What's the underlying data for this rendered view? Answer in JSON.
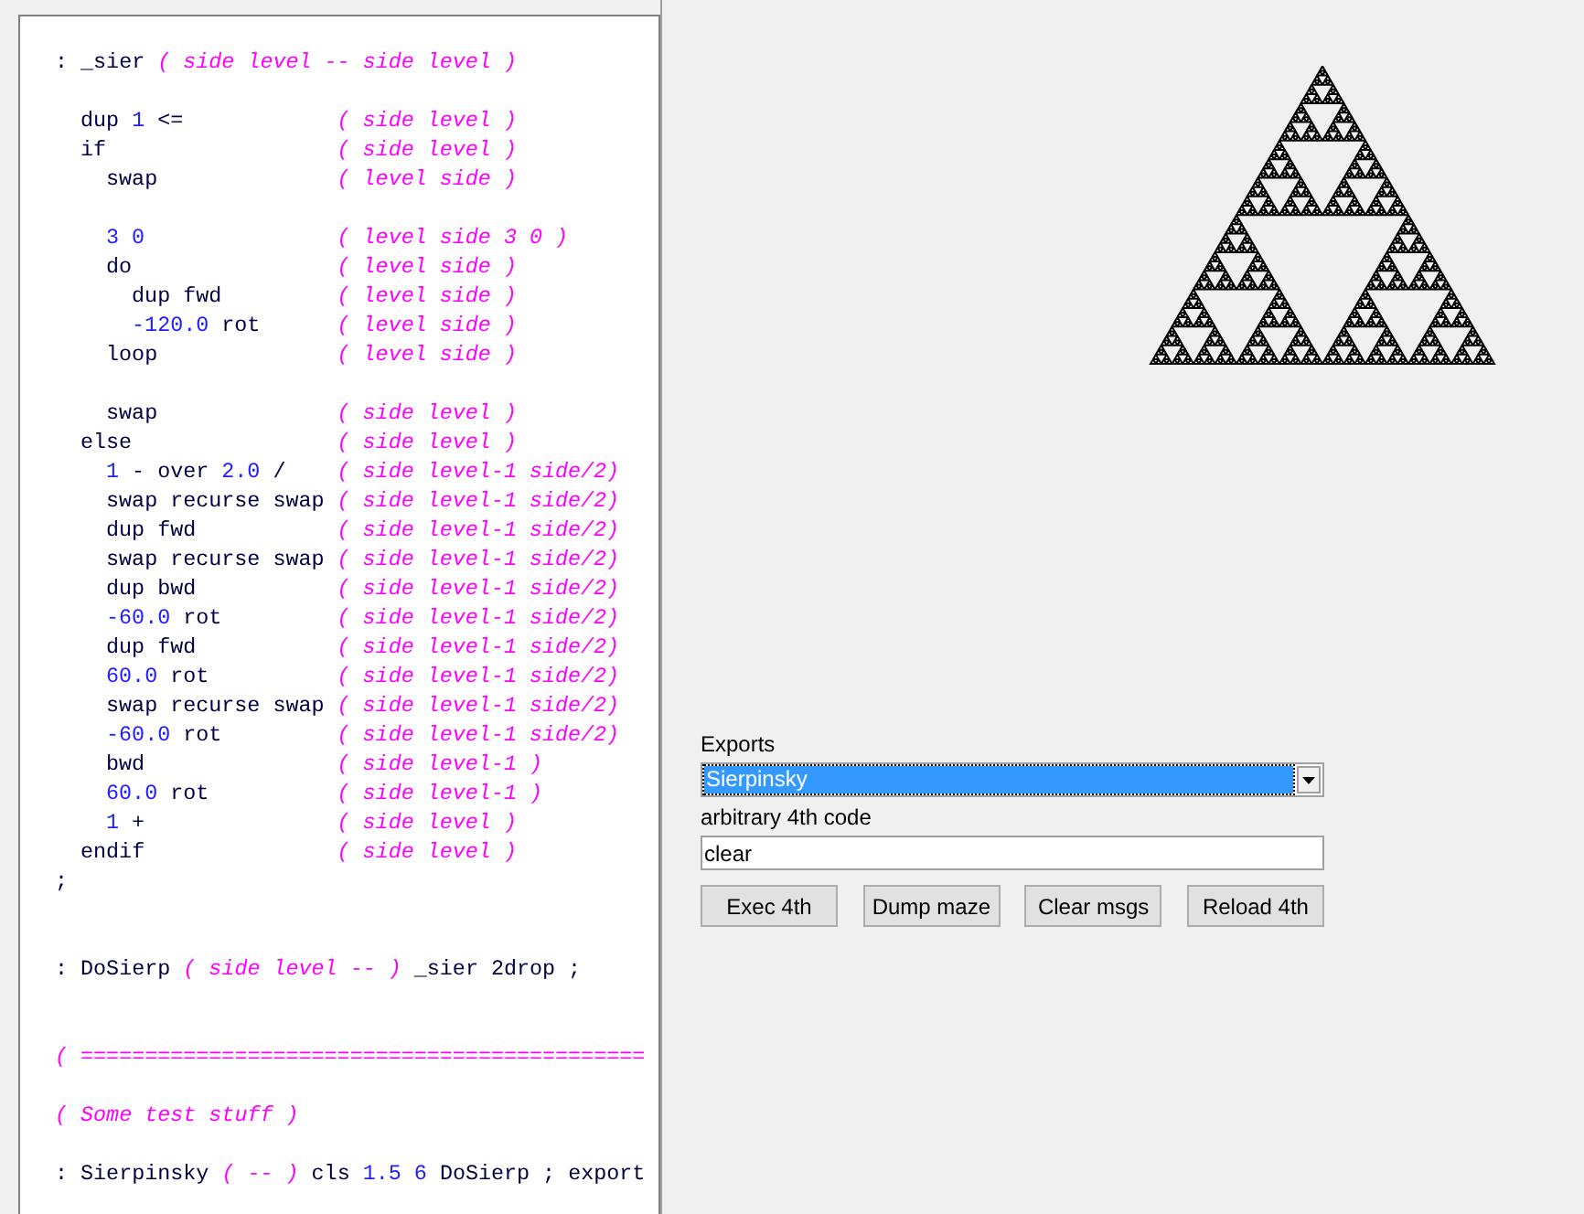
{
  "editor": {
    "lines": [
      {
        "kind": "code",
        "segments": [
          {
            "kind": "word",
            "t": ": _sier "
          },
          {
            "kind": "comment",
            "t": "( side level -- side level )"
          }
        ],
        "children": [
          {
            "kind": "blank"
          },
          {
            "kind": "code",
            "segments": [
              {
                "kind": "word",
                "t": "dup "
              },
              {
                "kind": "number",
                "t": "1"
              },
              {
                "kind": "word",
                "t": " <="
              }
            ],
            "comment": "( side level )"
          },
          {
            "kind": "code",
            "segments": [
              {
                "kind": "word",
                "t": "if"
              }
            ],
            "comment": "( side level )",
            "children": [
              {
                "kind": "code",
                "segments": [
                  {
                    "kind": "word",
                    "t": "swap"
                  }
                ],
                "comment": "( level side )"
              },
              {
                "kind": "blank"
              },
              {
                "kind": "code",
                "segments": [
                  {
                    "kind": "number",
                    "t": "3 0"
                  }
                ],
                "comment": "( level side 3 0 )"
              },
              {
                "kind": "code",
                "segments": [
                  {
                    "kind": "word",
                    "t": "do"
                  }
                ],
                "comment": "( level side )",
                "children": [
                  {
                    "kind": "code",
                    "segments": [
                      {
                        "kind": "word",
                        "t": "dup fwd"
                      }
                    ],
                    "comment": "( level side )"
                  },
                  {
                    "kind": "code",
                    "segments": [
                      {
                        "kind": "number",
                        "t": "-120.0"
                      },
                      {
                        "kind": "word",
                        "t": " rot"
                      }
                    ],
                    "comment": "( level side )"
                  }
                ]
              },
              {
                "kind": "code",
                "segments": [
                  {
                    "kind": "word",
                    "t": "loop"
                  }
                ],
                "comment": "( level side )"
              },
              {
                "kind": "blank"
              },
              {
                "kind": "code",
                "segments": [
                  {
                    "kind": "word",
                    "t": "swap"
                  }
                ],
                "comment": "( side level )"
              }
            ]
          },
          {
            "kind": "code",
            "segments": [
              {
                "kind": "word",
                "t": "else"
              }
            ],
            "comment": "( side level )",
            "children": [
              {
                "kind": "code",
                "segments": [
                  {
                    "kind": "number",
                    "t": "1"
                  },
                  {
                    "kind": "word",
                    "t": " - over "
                  },
                  {
                    "kind": "number",
                    "t": "2.0"
                  },
                  {
                    "kind": "word",
                    "t": " /"
                  }
                ],
                "comment": "( side level-1 side/2)"
              },
              {
                "kind": "code",
                "segments": [
                  {
                    "kind": "word",
                    "t": "swap recurse swap"
                  }
                ],
                "comment": "( side level-1 side/2)"
              },
              {
                "kind": "code",
                "segments": [
                  {
                    "kind": "word",
                    "t": "dup fwd"
                  }
                ],
                "comment": "( side level-1 side/2)"
              },
              {
                "kind": "code",
                "segments": [
                  {
                    "kind": "word",
                    "t": "swap recurse swap"
                  }
                ],
                "comment": "( side level-1 side/2)"
              },
              {
                "kind": "code",
                "segments": [
                  {
                    "kind": "word",
                    "t": "dup bwd"
                  }
                ],
                "comment": "( side level-1 side/2)"
              },
              {
                "kind": "code",
                "segments": [
                  {
                    "kind": "number",
                    "t": "-60.0"
                  },
                  {
                    "kind": "word",
                    "t": " rot"
                  }
                ],
                "comment": "( side level-1 side/2)"
              },
              {
                "kind": "code",
                "segments": [
                  {
                    "kind": "word",
                    "t": "dup fwd"
                  }
                ],
                "comment": "( side level-1 side/2)"
              },
              {
                "kind": "code",
                "segments": [
                  {
                    "kind": "number",
                    "t": "60.0"
                  },
                  {
                    "kind": "word",
                    "t": " rot"
                  }
                ],
                "comment": "( side level-1 side/2)"
              },
              {
                "kind": "code",
                "segments": [
                  {
                    "kind": "word",
                    "t": "swap recurse swap"
                  }
                ],
                "comment": "( side level-1 side/2)"
              },
              {
                "kind": "code",
                "segments": [
                  {
                    "kind": "number",
                    "t": "-60.0"
                  },
                  {
                    "kind": "word",
                    "t": " rot"
                  }
                ],
                "comment": "( side level-1 side/2)"
              },
              {
                "kind": "code",
                "segments": [
                  {
                    "kind": "word",
                    "t": "bwd"
                  }
                ],
                "comment": "( side level-1 )"
              },
              {
                "kind": "code",
                "segments": [
                  {
                    "kind": "number",
                    "t": "60.0"
                  },
                  {
                    "kind": "word",
                    "t": " rot"
                  }
                ],
                "comment": "( side level-1 )"
              },
              {
                "kind": "code",
                "segments": [
                  {
                    "kind": "number",
                    "t": "1"
                  },
                  {
                    "kind": "word",
                    "t": " +"
                  }
                ],
                "comment": "( side level )"
              }
            ]
          },
          {
            "kind": "code",
            "segments": [
              {
                "kind": "word",
                "t": "endif"
              }
            ],
            "comment": "( side level )"
          }
        ]
      },
      {
        "kind": "code",
        "segments": [
          {
            "kind": "word",
            "t": ";"
          }
        ]
      },
      {
        "kind": "blank"
      },
      {
        "kind": "blank"
      },
      {
        "kind": "code",
        "segments": [
          {
            "kind": "word",
            "t": ": DoSierp "
          },
          {
            "kind": "comment",
            "t": "( side level -- )"
          },
          {
            "kind": "word",
            "t": " _sier 2drop ;"
          }
        ]
      },
      {
        "kind": "blank"
      },
      {
        "kind": "blank"
      },
      {
        "kind": "code",
        "segments": [
          {
            "kind": "comment",
            "t": "( ============================================"
          }
        ]
      },
      {
        "kind": "blank"
      },
      {
        "kind": "code",
        "segments": [
          {
            "kind": "comment",
            "t": "( Some test stuff )"
          }
        ]
      },
      {
        "kind": "blank"
      },
      {
        "kind": "code",
        "segments": [
          {
            "kind": "word",
            "t": ": Sierpinsky "
          },
          {
            "kind": "comment",
            "t": "( -- )"
          },
          {
            "kind": "word",
            "t": " cls "
          },
          {
            "kind": "number",
            "t": "1.5 6"
          },
          {
            "kind": "word",
            "t": " DoSierp ; export"
          }
        ]
      }
    ]
  },
  "controls": {
    "exports_label": "Exports",
    "exports_value": "Sierpinsky",
    "exports_focused": true,
    "code_label": "arbitrary 4th code",
    "code_value": "clear",
    "buttons": [
      "Exec 4th",
      "Dump maze",
      "Clear msgs",
      "Reload 4th"
    ]
  }
}
